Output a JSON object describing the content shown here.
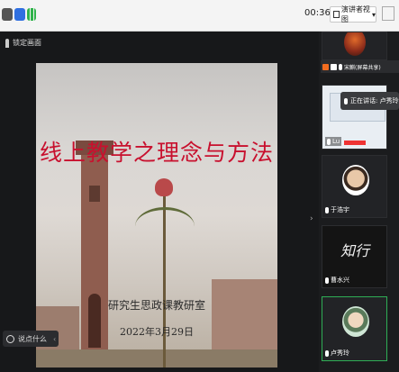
{
  "topbar": {
    "timer": "00:36",
    "view_label": "演讲者视图",
    "view_dropdown": "▾"
  },
  "main": {
    "pin_label": "锁定画面",
    "chat_label": "说点什么",
    "collapse_glyph": "›"
  },
  "slide": {
    "title": "线上教学之理念与方法",
    "subtitle": "研究生思政课教研室",
    "date": "2022年3月29日"
  },
  "sidebar": {
    "share_label": "宋麒(屏幕共享)",
    "tooltip": "正在讲话: 卢秀玲",
    "participants": [
      {
        "name": "Lu"
      },
      {
        "name": "于浩宇"
      },
      {
        "name": "曹水兴"
      },
      {
        "name": "卢秀玲"
      }
    ]
  }
}
